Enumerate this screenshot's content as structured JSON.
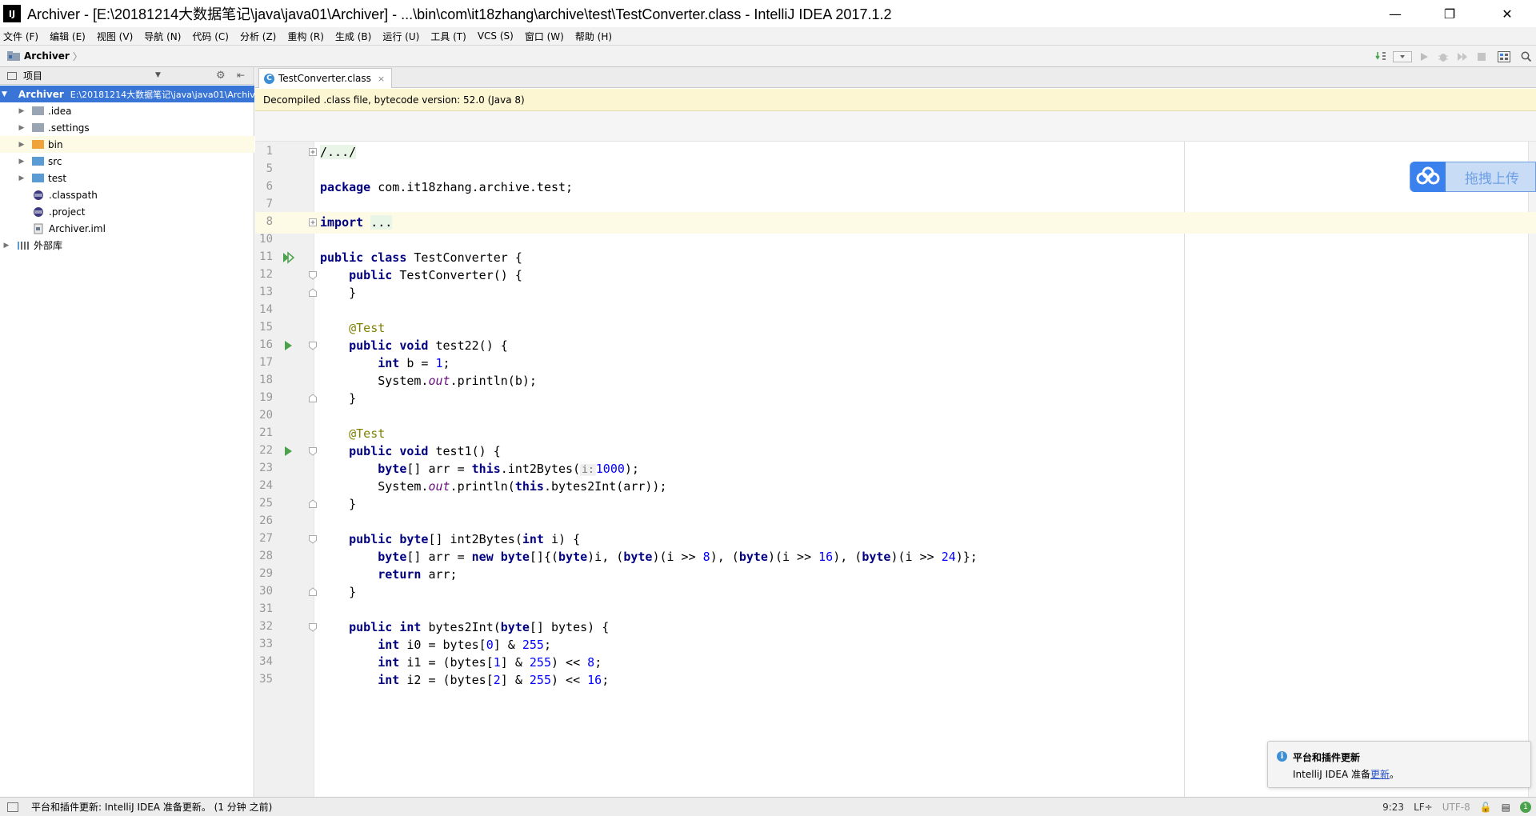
{
  "window": {
    "title": "Archiver - [E:\\20181214大数据笔记\\java\\java01\\Archiver] - ...\\bin\\com\\it18zhang\\archive\\test\\TestConverter.class - IntelliJ IDEA 2017.1.2",
    "app_icon_label": "IJ",
    "minimize": "—",
    "maximize": "❐",
    "close": "✕"
  },
  "menu": [
    "文件 (F)",
    "编辑 (E)",
    "视图 (V)",
    "导航 (N)",
    "代码 (C)",
    "分析 (Z)",
    "重构 (R)",
    "生成 (B)",
    "运行 (U)",
    "工具 (T)",
    "VCS (S)",
    "窗口 (W)",
    "帮助 (H)"
  ],
  "navbar": {
    "project": "Archiver",
    "chevron": "〉"
  },
  "project_panel": {
    "header": "项目",
    "tree": [
      {
        "label": "Archiver",
        "path": "E:\\20181214大数据笔记\\java\\java01\\Archiver",
        "expanded": true,
        "type": "module",
        "selected": true
      },
      {
        "label": ".idea",
        "type": "folder",
        "color": "#9aa5b3"
      },
      {
        "label": ".settings",
        "type": "folder",
        "color": "#9aa5b3"
      },
      {
        "label": "bin",
        "type": "folder",
        "color": "#f0a33a",
        "highlight": true
      },
      {
        "label": "src",
        "type": "folder",
        "color": "#5a9bd6"
      },
      {
        "label": "test",
        "type": "folder",
        "color": "#5a9bd6"
      },
      {
        "label": ".classpath",
        "type": "file"
      },
      {
        "label": ".project",
        "type": "file"
      },
      {
        "label": "Archiver.iml",
        "type": "file"
      },
      {
        "label": "外部库",
        "type": "library"
      }
    ]
  },
  "editor": {
    "tab": {
      "label": "TestConverter.class",
      "icon_letter": "C",
      "close": "×"
    },
    "banner": "Decompiled .class file, bytecode version: 52.0 (Java 8)",
    "line_numbers": [
      "1",
      "5",
      "6",
      "7",
      "8",
      "10",
      "11",
      "12",
      "13",
      "14",
      "15",
      "16",
      "17",
      "18",
      "19",
      "20",
      "21",
      "22",
      "23",
      "24",
      "25",
      "26",
      "27",
      "28",
      "29",
      "30",
      "31",
      "32",
      "33",
      "34",
      "35"
    ],
    "hint": "i:"
  },
  "upload_widget": {
    "label": "拖拽上传"
  },
  "notification": {
    "title": "平台和插件更新",
    "body_prefix": "IntelliJ IDEA 准备",
    "link": "更新",
    "body_suffix": "。"
  },
  "statusbar": {
    "message": "平台和插件更新: IntelliJ IDEA 准备更新。 (1 分钟 之前)",
    "position": "9:23",
    "line_separator": "LF÷",
    "encoding": "UTF-8",
    "event_count": "1"
  },
  "colors": {
    "keyword": "#000080",
    "number": "#0000ff",
    "annotation": "#808000",
    "banner_bg": "#fdf6d2",
    "selection": "#3875d7"
  }
}
